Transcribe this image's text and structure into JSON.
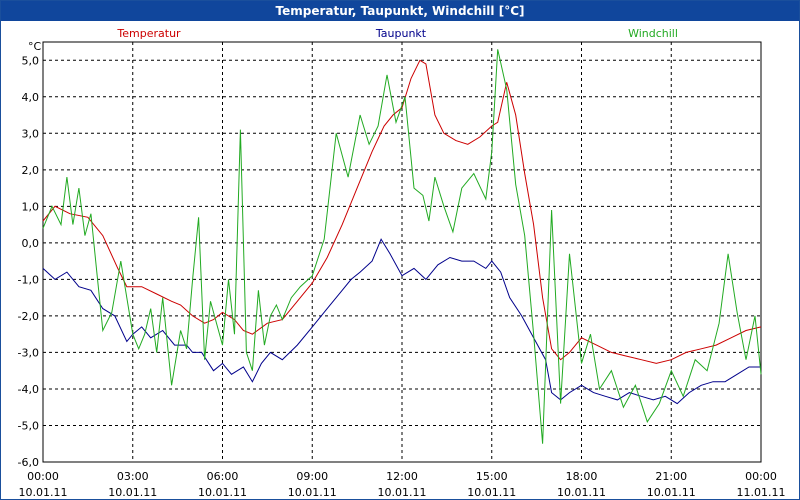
{
  "window": {
    "title": "Temperatur, Taupunkt, Windchill [°C]"
  },
  "chart_data": {
    "type": "line",
    "title": "Temperatur, Taupunkt, Windchill [°C]",
    "ylabel": "°C",
    "xlabel": "",
    "ylim": [
      -6,
      5.5
    ],
    "xlim": [
      0,
      24
    ],
    "grid": true,
    "legend_position": "top",
    "y_ticks": [
      "5,0",
      "4,0",
      "3,0",
      "2,0",
      "1,0",
      "0,0",
      "-1,0",
      "-2,0",
      "-3,0",
      "-4,0",
      "-5,0",
      "-6,0"
    ],
    "y_tick_values": [
      5,
      4,
      3,
      2,
      1,
      0,
      -1,
      -2,
      -3,
      -4,
      -5,
      -6
    ],
    "x_ticks": [
      {
        "time": "00:00",
        "date": "10.01.11",
        "hour": 0
      },
      {
        "time": "03:00",
        "date": "10.01.11",
        "hour": 3
      },
      {
        "time": "06:00",
        "date": "10.01.11",
        "hour": 6
      },
      {
        "time": "09:00",
        "date": "10.01.11",
        "hour": 9
      },
      {
        "time": "12:00",
        "date": "10.01.11",
        "hour": 12
      },
      {
        "time": "15:00",
        "date": "10.01.11",
        "hour": 15
      },
      {
        "time": "18:00",
        "date": "10.01.11",
        "hour": 18
      },
      {
        "time": "21:00",
        "date": "10.01.11",
        "hour": 21
      },
      {
        "time": "00:00",
        "date": "11.01.11",
        "hour": 24
      }
    ],
    "series": [
      {
        "name": "Temperatur",
        "color": "#cc0000",
        "x": [
          0,
          0.4,
          0.9,
          1.5,
          2.0,
          2.5,
          2.8,
          3.0,
          3.3,
          3.8,
          4.3,
          4.6,
          5.0,
          5.4,
          5.7,
          6.0,
          6.4,
          6.7,
          7.0,
          7.5,
          8.0,
          8.5,
          9.0,
          9.5,
          10.0,
          10.5,
          11.0,
          11.4,
          11.7,
          12.0,
          12.3,
          12.6,
          12.8,
          13.1,
          13.4,
          13.8,
          14.2,
          14.6,
          15.0,
          15.2,
          15.5,
          15.8,
          16.1,
          16.4,
          16.7,
          17.0,
          17.3,
          17.6,
          18.0,
          18.5,
          19.0,
          19.5,
          20.0,
          20.5,
          21.0,
          21.5,
          22.0,
          22.5,
          23.0,
          23.5,
          24.0
        ],
        "y": [
          0.6,
          1.0,
          0.8,
          0.7,
          0.2,
          -0.7,
          -1.2,
          -1.2,
          -1.2,
          -1.4,
          -1.6,
          -1.7,
          -2.0,
          -2.2,
          -2.1,
          -1.9,
          -2.1,
          -2.4,
          -2.5,
          -2.2,
          -2.1,
          -1.6,
          -1.1,
          -0.4,
          0.5,
          1.5,
          2.5,
          3.2,
          3.5,
          3.7,
          4.5,
          5.0,
          4.9,
          3.5,
          3.0,
          2.8,
          2.7,
          2.9,
          3.2,
          3.3,
          4.4,
          3.5,
          1.9,
          0.5,
          -1.5,
          -2.9,
          -3.2,
          -3.0,
          -2.6,
          -2.8,
          -3.0,
          -3.1,
          -3.2,
          -3.3,
          -3.2,
          -3.0,
          -2.9,
          -2.8,
          -2.6,
          -2.4,
          -2.3
        ]
      },
      {
        "name": "Taupunkt",
        "color": "#00008b",
        "x": [
          0,
          0.4,
          0.8,
          1.2,
          1.6,
          2.0,
          2.4,
          2.8,
          3.0,
          3.3,
          3.6,
          4.0,
          4.4,
          4.8,
          5.0,
          5.3,
          5.7,
          6.0,
          6.3,
          6.7,
          7.0,
          7.3,
          7.6,
          8.0,
          8.5,
          9.0,
          9.5,
          10.0,
          10.3,
          10.6,
          11.0,
          11.3,
          11.6,
          12.0,
          12.4,
          12.8,
          13.2,
          13.6,
          14.0,
          14.4,
          14.8,
          15.0,
          15.3,
          15.6,
          16.0,
          16.4,
          16.8,
          17.0,
          17.3,
          17.6,
          18.0,
          18.4,
          18.8,
          19.2,
          19.6,
          20.0,
          20.4,
          20.8,
          21.2,
          21.6,
          22.0,
          22.4,
          22.8,
          23.2,
          23.6,
          24.0
        ],
        "y": [
          -0.7,
          -1.0,
          -0.8,
          -1.2,
          -1.3,
          -1.8,
          -2.0,
          -2.7,
          -2.5,
          -2.3,
          -2.6,
          -2.4,
          -2.8,
          -2.8,
          -3.0,
          -3.0,
          -3.5,
          -3.3,
          -3.6,
          -3.4,
          -3.8,
          -3.3,
          -3.0,
          -3.2,
          -2.8,
          -2.3,
          -1.8,
          -1.3,
          -1.0,
          -0.8,
          -0.5,
          0.1,
          -0.3,
          -0.9,
          -0.7,
          -1.0,
          -0.6,
          -0.4,
          -0.5,
          -0.5,
          -0.7,
          -0.5,
          -0.8,
          -1.5,
          -2.0,
          -2.6,
          -3.2,
          -4.1,
          -4.3,
          -4.1,
          -3.9,
          -4.1,
          -4.2,
          -4.3,
          -4.1,
          -4.2,
          -4.3,
          -4.2,
          -4.4,
          -4.1,
          -3.9,
          -3.8,
          -3.8,
          -3.6,
          -3.4,
          -3.4
        ]
      },
      {
        "name": "Windchill",
        "color": "#22aa22",
        "x": [
          0,
          0.3,
          0.6,
          0.8,
          1.0,
          1.2,
          1.4,
          1.6,
          1.8,
          2.0,
          2.3,
          2.6,
          2.8,
          3.0,
          3.2,
          3.4,
          3.6,
          3.8,
          4.0,
          4.3,
          4.6,
          4.8,
          5.0,
          5.2,
          5.4,
          5.6,
          5.8,
          6.0,
          6.2,
          6.4,
          6.6,
          6.8,
          7.0,
          7.2,
          7.4,
          7.6,
          7.8,
          8.0,
          8.3,
          8.6,
          9.0,
          9.4,
          9.8,
          10.2,
          10.6,
          10.9,
          11.2,
          11.5,
          11.8,
          12.1,
          12.4,
          12.7,
          12.9,
          13.1,
          13.4,
          13.7,
          14.0,
          14.4,
          14.8,
          15.0,
          15.2,
          15.5,
          15.8,
          16.1,
          16.4,
          16.7,
          17.0,
          17.3,
          17.6,
          18.0,
          18.3,
          18.6,
          19.0,
          19.4,
          19.8,
          20.2,
          20.6,
          21.0,
          21.4,
          21.8,
          22.2,
          22.6,
          22.9,
          23.2,
          23.5,
          23.8,
          24.0
        ],
        "y": [
          0.4,
          1.0,
          0.5,
          1.8,
          0.5,
          1.5,
          0.2,
          0.8,
          -0.8,
          -2.4,
          -1.9,
          -0.5,
          -1.5,
          -2.5,
          -2.9,
          -2.5,
          -1.8,
          -3.0,
          -1.5,
          -3.9,
          -2.4,
          -2.9,
          -1.0,
          0.7,
          -3.2,
          -1.6,
          -2.2,
          -2.8,
          -1.0,
          -2.5,
          3.1,
          -3.0,
          -3.5,
          -1.3,
          -2.8,
          -2.0,
          -1.7,
          -2.1,
          -1.5,
          -1.2,
          -0.9,
          0.1,
          3.0,
          1.8,
          3.5,
          2.7,
          3.2,
          4.6,
          3.3,
          4.0,
          1.5,
          1.3,
          0.6,
          1.8,
          1.0,
          0.3,
          1.5,
          1.9,
          1.2,
          2.5,
          5.3,
          4.2,
          1.6,
          0.2,
          -2.5,
          -5.5,
          0.9,
          -4.4,
          -0.3,
          -3.3,
          -2.5,
          -4.0,
          -3.5,
          -4.5,
          -3.9,
          -4.9,
          -4.4,
          -3.5,
          -4.2,
          -3.2,
          -3.5,
          -2.2,
          -0.3,
          -1.9,
          -3.2,
          -2.0,
          -3.6
        ]
      }
    ]
  }
}
